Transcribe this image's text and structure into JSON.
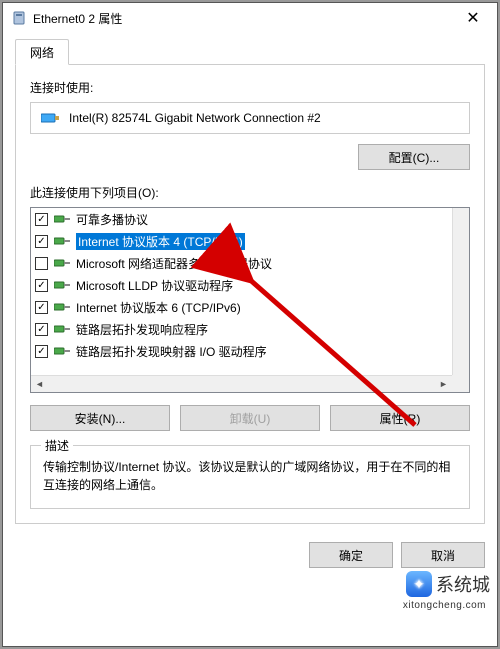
{
  "window": {
    "title": "Ethernet0 2 属性",
    "close": "✕"
  },
  "tab": {
    "label": "网络"
  },
  "connect_using": {
    "label": "连接时使用:",
    "adapter": "Intel(R) 82574L Gigabit Network Connection #2",
    "configure_btn": "配置(C)..."
  },
  "items_label": "此连接使用下列项目(O):",
  "items": [
    {
      "checked": true,
      "label": "可靠多播协议",
      "selected": false
    },
    {
      "checked": true,
      "label": "Internet 协议版本 4 (TCP/IPv4)",
      "selected": true
    },
    {
      "checked": false,
      "label": "Microsoft 网络适配器多路传送器协议",
      "selected": false
    },
    {
      "checked": true,
      "label": "Microsoft LLDP 协议驱动程序",
      "selected": false
    },
    {
      "checked": true,
      "label": "Internet 协议版本 6 (TCP/IPv6)",
      "selected": false
    },
    {
      "checked": true,
      "label": "链路层拓扑发现响应程序",
      "selected": false
    },
    {
      "checked": true,
      "label": "链路层拓扑发现映射器 I/O 驱动程序",
      "selected": false
    }
  ],
  "buttons": {
    "install": "安装(N)...",
    "uninstall": "卸载(U)",
    "properties": "属性(R)"
  },
  "description": {
    "title": "描述",
    "text": "传输控制协议/Internet 协议。该协议是默认的广域网络协议，用于在不同的相互连接的网络上通信。"
  },
  "dialog": {
    "ok": "确定",
    "cancel": "取消"
  },
  "watermark": {
    "brand": "系统城",
    "url": "xitongcheng.com"
  }
}
